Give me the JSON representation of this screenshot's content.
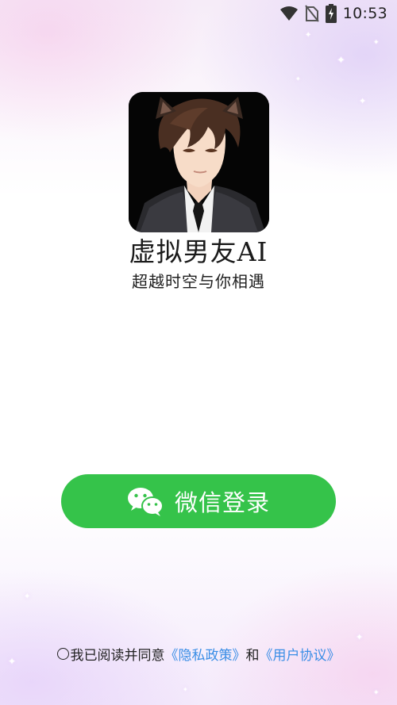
{
  "status_bar": {
    "time": "10:53",
    "icons": [
      "wifi-icon",
      "no-sim-icon",
      "battery-charging-icon"
    ]
  },
  "app": {
    "icon": "boyfriend-avatar-icon",
    "title": "虚拟男友AI",
    "subtitle": "超越时空与你相遇"
  },
  "login": {
    "wechat_label": "微信登录",
    "icon": "wechat-icon",
    "color": "#35c34a"
  },
  "agreement": {
    "prefix": "我已阅读并同意",
    "privacy_link": "《隐私政策》",
    "conjunction": "和",
    "terms_link": "《用户协议》",
    "link_color": "#3a8ee6",
    "checked": false
  }
}
